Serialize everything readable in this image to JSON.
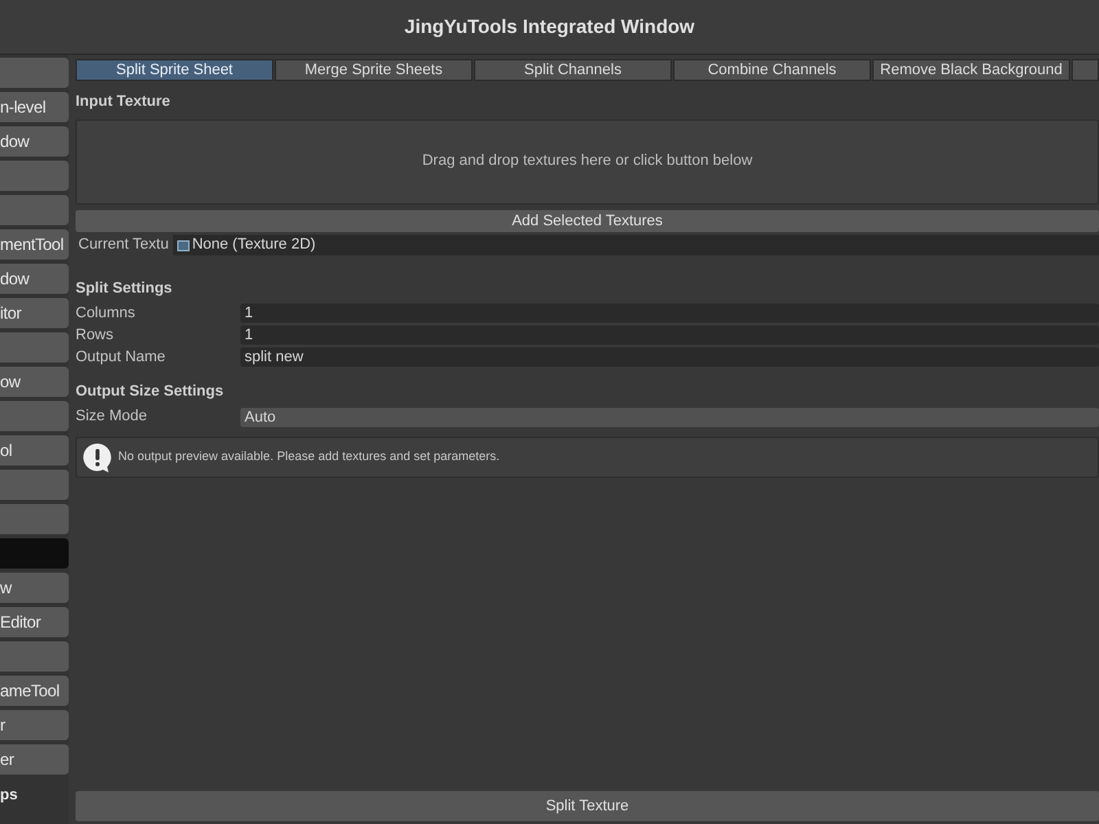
{
  "window": {
    "title": "JingYuTools Integrated Window"
  },
  "sidebar": {
    "items": [
      {
        "selected": false
      },
      {
        "label": "n-level",
        "selected": false
      },
      {
        "label": "dow",
        "selected": false
      },
      {
        "selected": false
      },
      {
        "selected": false
      },
      {
        "label": "mentTool",
        "selected": false
      },
      {
        "label": "dow",
        "selected": false
      },
      {
        "label": "itor",
        "selected": false
      },
      {
        "selected": false
      },
      {
        "label": "ow",
        "selected": false
      },
      {
        "selected": false
      },
      {
        "label": "ol",
        "selected": false
      },
      {
        "selected": false
      },
      {
        "selected": false
      },
      {
        "selected": true
      },
      {
        "label": "w",
        "selected": false
      },
      {
        "label": "Editor",
        "selected": false
      },
      {
        "selected": false
      },
      {
        "label": "ameTool",
        "selected": false
      },
      {
        "label": "r",
        "selected": false
      },
      {
        "label": "er",
        "selected": false
      }
    ],
    "footer": "ps"
  },
  "tabs": [
    {
      "label": "Split Sprite Sheet",
      "selected": true
    },
    {
      "label": "Merge Sprite Sheets",
      "selected": false
    },
    {
      "label": "Split Channels",
      "selected": false
    },
    {
      "label": "Combine Channels",
      "selected": false
    },
    {
      "label": "Remove Black Background",
      "selected": false
    }
  ],
  "input_texture": {
    "heading": "Input Texture",
    "drop_zone": "Drag and drop textures here or click button below",
    "add_button": "Add Selected Textures",
    "current_label": "Current Textu",
    "current_value": "None (Texture 2D)"
  },
  "split_settings": {
    "heading": "Split Settings",
    "fields": [
      {
        "label": "Columns",
        "value": "1"
      },
      {
        "label": "Rows",
        "value": "1"
      },
      {
        "label": "Output Name",
        "value": "split new"
      }
    ]
  },
  "output_size": {
    "heading": "Output Size Settings",
    "fields": [
      {
        "label": "Size Mode",
        "value": "Auto"
      }
    ]
  },
  "message": "No output preview available. Please add textures and set parameters.",
  "action_button": "Split Texture"
}
